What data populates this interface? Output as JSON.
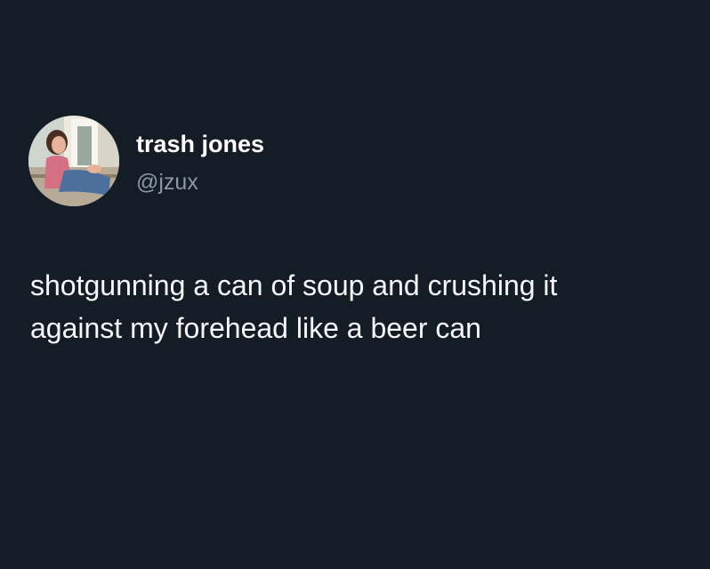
{
  "theme": {
    "background": "#141c26",
    "name_color": "#ffffff",
    "handle_color": "#8b98a5",
    "text_color": "#f5f7f9"
  },
  "author": {
    "display_name": "trash jones",
    "handle": "@jzux",
    "avatar_icon": "user-avatar-photo"
  },
  "tweet": {
    "lines": [
      "shotgunning a can of soup and crushing it",
      "against my forehead like a beer can"
    ]
  }
}
